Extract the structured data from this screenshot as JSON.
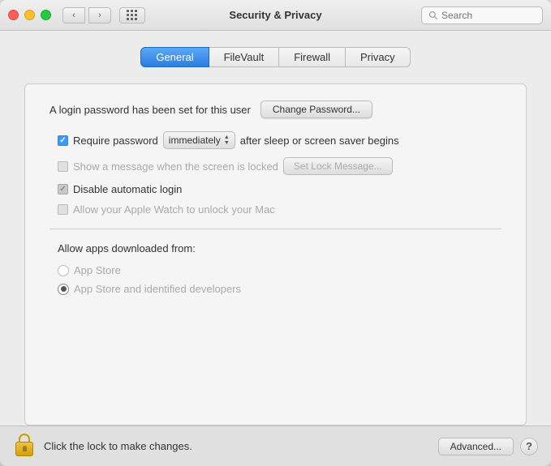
{
  "titlebar": {
    "title": "Security & Privacy",
    "search_placeholder": "Search"
  },
  "tabs": [
    {
      "label": "General",
      "active": true
    },
    {
      "label": "FileVault",
      "active": false
    },
    {
      "label": "Firewall",
      "active": false
    },
    {
      "label": "Privacy",
      "active": false
    }
  ],
  "general": {
    "login_password_text": "A login password has been set for this user",
    "change_password_label": "Change Password...",
    "require_password_label": "Require password",
    "immediately_value": "immediately",
    "after_sleep_text": "after sleep or screen saver begins",
    "show_message_label": "Show a message when the screen is locked",
    "set_lock_message_label": "Set Lock Message...",
    "disable_autologin_label": "Disable automatic login",
    "allow_watch_label": "Allow your Apple Watch to unlock your Mac"
  },
  "apps_section": {
    "title": "Allow apps downloaded from:",
    "options": [
      {
        "label": "App Store",
        "selected": false
      },
      {
        "label": "App Store and identified developers",
        "selected": true
      }
    ]
  },
  "bottom_bar": {
    "lock_message": "Click the lock to make changes.",
    "advanced_label": "Advanced...",
    "help_label": "?"
  }
}
